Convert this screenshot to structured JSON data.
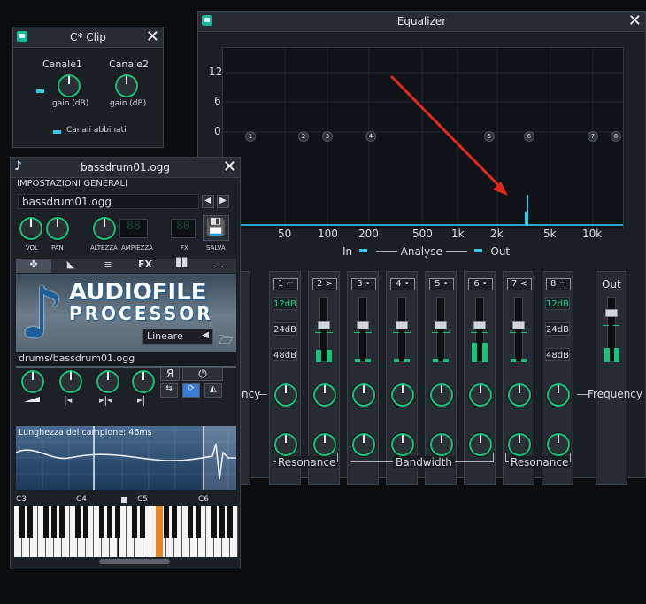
{
  "clip_window": {
    "title": "C* Clip",
    "channel1_label": "Canale1",
    "channel2_label": "Canale2",
    "gain1_label": "gain (dB)",
    "gain2_label": "gain (dB)",
    "link_label": "Canali abbinati"
  },
  "eq_window": {
    "title": "Equalizer",
    "y_ticks": [
      "12",
      "6",
      "0"
    ],
    "x_ticks": [
      "50",
      "100",
      "200",
      "500",
      "1k",
      "2k",
      "5k",
      "10k"
    ],
    "band_nodes": [
      "1",
      "2",
      "3",
      "4",
      "5",
      "6",
      "7",
      "8"
    ],
    "legend_in": "In",
    "legend_analyse": "Analyse",
    "legend_out": "Out",
    "band_labels": [
      "1",
      "2",
      "3",
      "4",
      "5",
      "6",
      "7",
      "8"
    ],
    "db_options": [
      "12dB",
      "24dB",
      "48dB"
    ],
    "out_label": "Out",
    "frequency_label": "Frequency",
    "frequency_label_left": "ncy",
    "resonance_label_left": "Resonance",
    "bandwidth_label": "Bandwidth",
    "resonance_label_right": "Resonance"
  },
  "afp_window": {
    "title": "bassdrum01.ogg",
    "section_title": "IMPOSTAZIONI GENERALI",
    "preset_name": "bassdrum01.ogg",
    "knob_labels": [
      "VOL",
      "PAN",
      "ALTEZZA",
      "AMPIEZZA",
      "FX",
      "SALVA"
    ],
    "tabs": [
      "✤",
      "◣",
      "≡",
      "FX",
      "▊▊",
      "…"
    ],
    "logo_line1": "AUDIOFILE",
    "logo_line2": "PROCESSOR",
    "interp_select": "Lineare",
    "file_path": "drums/bassdrum01.ogg",
    "reverse_label": "Я",
    "sample_length_label": "Lunghezza del campione: 46ms",
    "piano_octaves": [
      "C3",
      "C4",
      "C5",
      "C6"
    ]
  }
}
